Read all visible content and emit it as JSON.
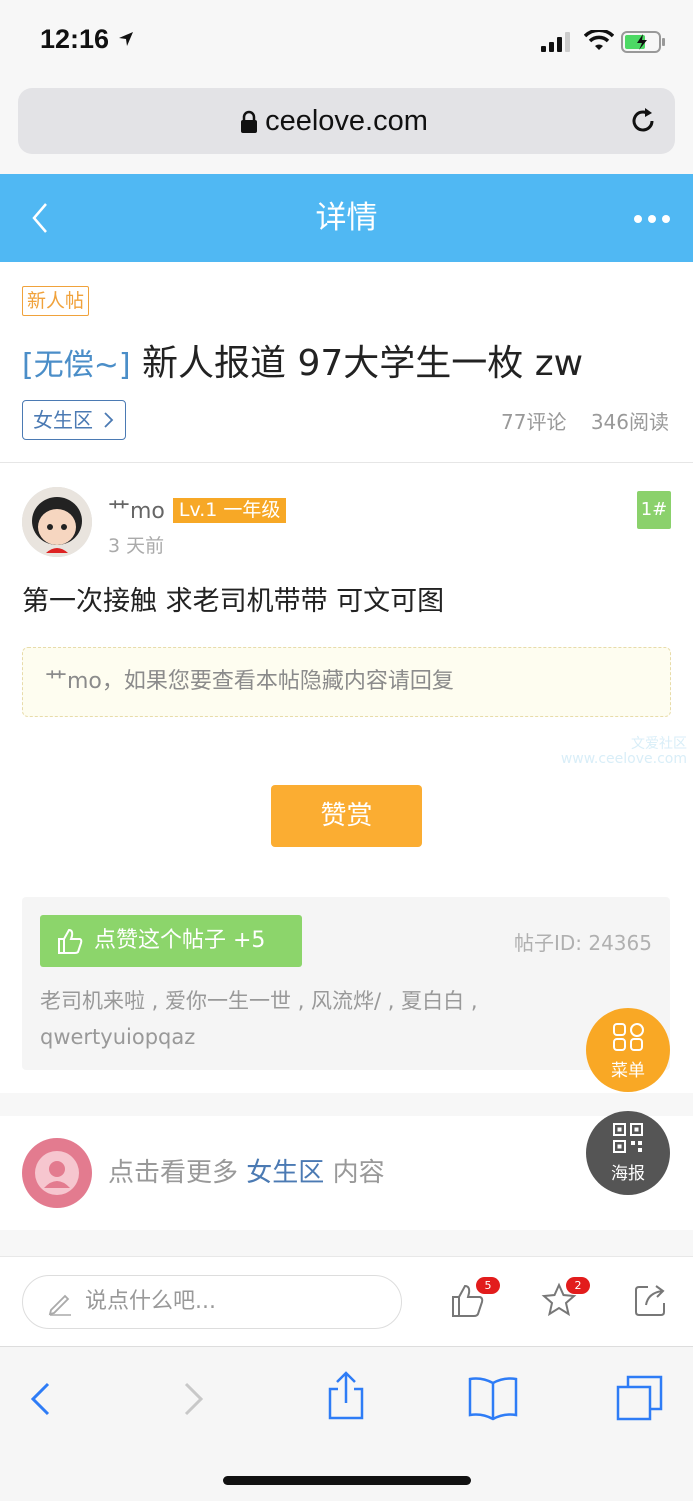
{
  "status_bar": {
    "time": "12:16"
  },
  "browser": {
    "url": "ceelove.com"
  },
  "header": {
    "title": "详情"
  },
  "post": {
    "badge": "新人帖",
    "title_prefix": "[无偿~]",
    "title": "新人报道 97大学生一枚 zw",
    "section": "女生区",
    "comments": "77评论",
    "reads": "346阅读"
  },
  "author": {
    "name": "艹mo",
    "level": "Lv.1 一年级",
    "time": "3 天前",
    "floor": "1#"
  },
  "content": {
    "text": "第一次接触 求老司机带带 可文可图",
    "hidden_notice": "艹mo，如果您要查看本帖隐藏内容请回复",
    "watermark_line1": "文爱社区",
    "watermark_line2": "www.ceelove.com",
    "reward_button": "赞赏"
  },
  "like_card": {
    "button": "点赞这个帖子 +5",
    "post_id": "帖子ID: 24365",
    "likers": "老司机来啦 , 爱你一生一世 , 风流烨/ , 夏白白 , qwertyuiopqaz"
  },
  "more": {
    "prefix": "点击看更多",
    "section": "女生区",
    "suffix": "内容"
  },
  "float_buttons": {
    "menu": "菜单",
    "poster": "海报"
  },
  "comment_bar": {
    "placeholder": "说点什么吧...",
    "like_count": "5",
    "fav_count": "2"
  },
  "colors": {
    "header": "#50b8f3",
    "accent_orange": "#fbad32",
    "like_green": "#8cd56b",
    "link_blue": "#4b7ab3"
  }
}
